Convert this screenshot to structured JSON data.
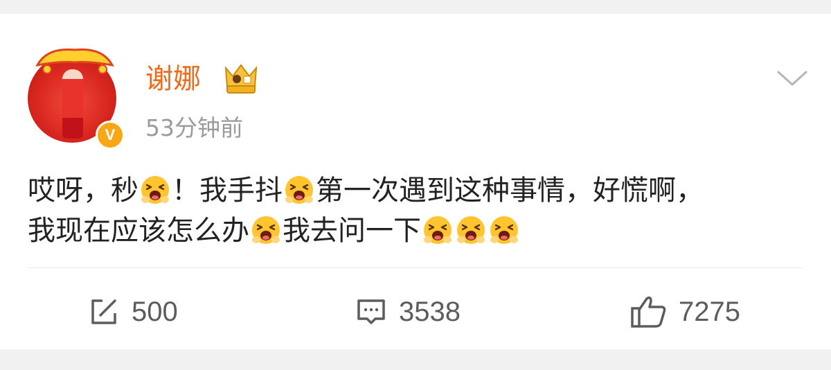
{
  "post": {
    "author": "谢娜",
    "timestamp": "53分钟前",
    "text_line1_parts": [
      "哎呀，秒",
      "！我手抖",
      "第一次遇到这种事情，好慌啊，"
    ],
    "text_line2_parts": [
      "我现在应该怎么办",
      "我去问一下"
    ],
    "emoji_name": "crying-face"
  },
  "avatar": {
    "verified_mark": "V"
  },
  "actions": {
    "repost_count": "500",
    "comment_count": "3538",
    "like_count": "7275"
  },
  "colors": {
    "username": "#ef6a1b",
    "timestamp": "#9a9a9a",
    "text": "#222222",
    "icon": "#5c5c5c",
    "verified": "#f8a814"
  }
}
